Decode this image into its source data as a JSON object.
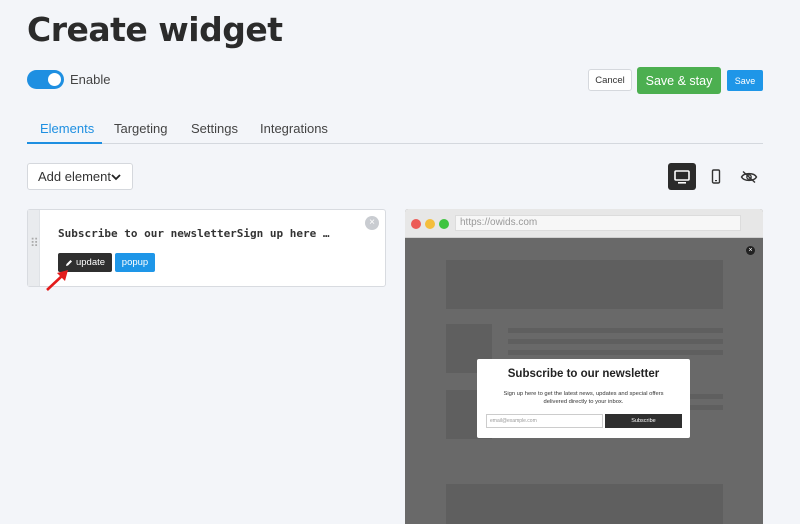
{
  "page": {
    "title": "Create widget"
  },
  "enable": {
    "label": "Enable",
    "on": true
  },
  "actions": {
    "cancel": "Cancel",
    "save_stay": "Save & stay",
    "save": "Save"
  },
  "tabs": [
    {
      "label": "Elements",
      "active": true
    },
    {
      "label": "Targeting",
      "active": false
    },
    {
      "label": "Settings",
      "active": false
    },
    {
      "label": "Integrations",
      "active": false
    }
  ],
  "toolbar": {
    "add_element": "Add element",
    "devices": [
      "desktop-icon",
      "mobile-icon",
      "eye-slash-icon"
    ],
    "active_device": "desktop"
  },
  "element": {
    "text": "Subscribe to our newsletterSign up here to get the latest news, updates and special offers delivered directly to your inbox.",
    "update_label": "update",
    "type_label": "popup"
  },
  "preview": {
    "url": "https://owids.com",
    "popup": {
      "title": "Subscribe to our newsletter",
      "description": "Sign up here to get the latest news, updates and special offers delivered directly to your inbox.",
      "email_placeholder": "email@example.com",
      "button": "Subscribe"
    }
  },
  "colors": {
    "accent": "#1e8fe1",
    "success": "#4caf50",
    "dark": "#2b2b2b",
    "overlay": "#696969"
  }
}
